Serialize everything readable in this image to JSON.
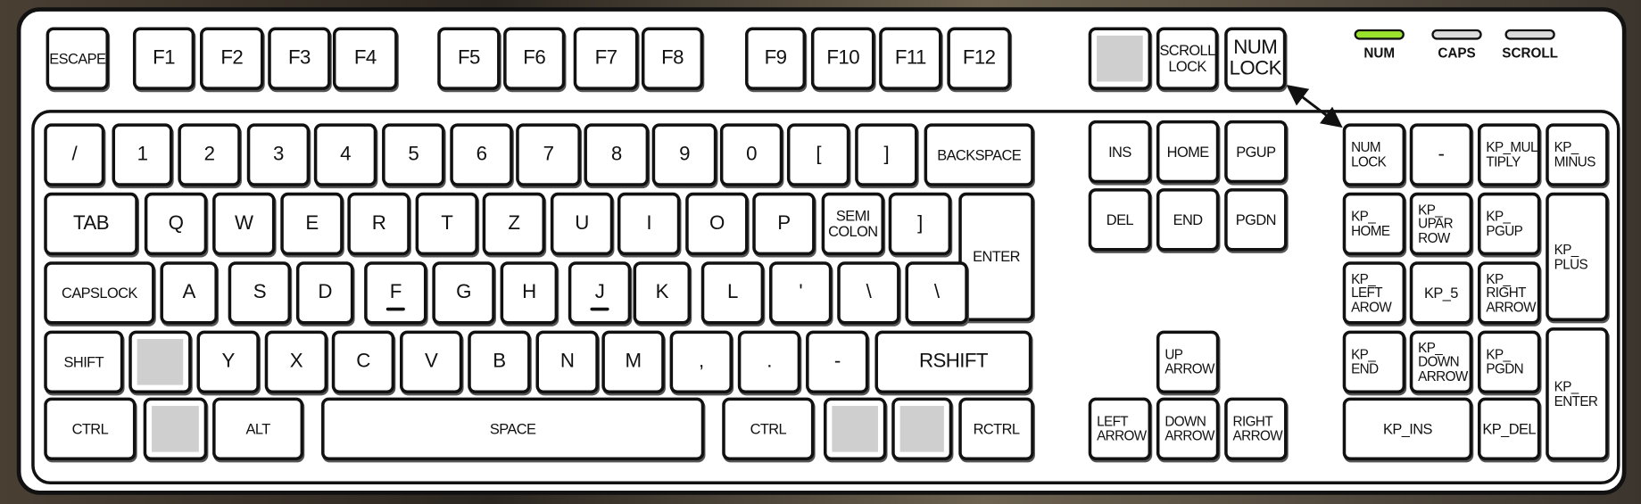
{
  "keys": [
    "ESCAPE",
    "F1",
    "F2",
    "F3",
    "F4",
    "F5",
    "F6",
    "F7",
    "F8",
    "F9",
    "F10",
    "F11",
    "F12",
    "",
    "SCROLL\nLOCK",
    "NUM\nLOCK",
    "/",
    "1",
    "2",
    "3",
    "4",
    "5",
    "6",
    "7",
    "8",
    "9",
    "0",
    "[",
    "]",
    "BACKSPACE",
    "TAB",
    "Q",
    "W",
    "E",
    "R",
    "T",
    "Z",
    "U",
    "I",
    "O",
    "P",
    "SEMI\nCOLON",
    "]",
    "ENTER",
    "CAPSLOCK",
    "A",
    "S",
    "D",
    "F",
    "G",
    "H",
    "J",
    "K",
    "L",
    "'",
    "\\",
    "\\",
    "SHIFT",
    "",
    "Y",
    "X",
    "C",
    "V",
    "B",
    "N",
    "M",
    ",",
    ".",
    "-",
    "RSHIFT",
    "CTRL",
    "",
    "ALT",
    "SPACE",
    "CTRL",
    "",
    "",
    "RCTRL",
    "INS",
    "HOME",
    "PGUP",
    "DEL",
    "END",
    "PGDN",
    "UP\nARROW",
    "LEFT\nARROW",
    "DOWN\nARROW",
    "RIGHT\nARROW",
    "NUM\nLOCK",
    "-",
    "KP_MUL\nTIPLY",
    "KP_\nMINUS",
    "KP_\nHOME",
    "KP_\nUPAR\nROW",
    "KP_\nPGUP",
    "KP_\nPLUS",
    "KP_\nLEFT\nAROW",
    "KP_5",
    "KP_\nRIGHT\nARROW",
    "KP_\nEND",
    "KP_\nDOWN\nARROW",
    "KP_\nPGDN",
    "KP_\nENTER",
    "KP_INS",
    "KP_DEL"
  ],
  "indicators": [
    {
      "label": "NUM",
      "state": "on",
      "color": "#9be22d"
    },
    {
      "label": "CAPS",
      "state": "off",
      "color": "#dddddd"
    },
    {
      "label": "SCROLL",
      "state": "off",
      "color": "#dddddd"
    }
  ],
  "home_row_bumps": [
    "F",
    "J"
  ]
}
